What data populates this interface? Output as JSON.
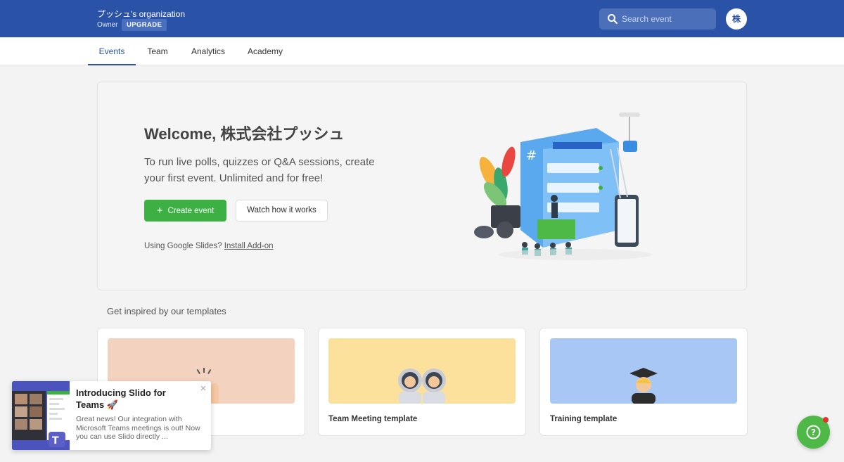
{
  "header": {
    "org_name": "プッシュ's organization",
    "role": "Owner",
    "upgrade_label": "UPGRADE",
    "search_placeholder": "Search event",
    "avatar_initial": "株"
  },
  "nav": {
    "tabs": [
      {
        "label": "Events",
        "active": true
      },
      {
        "label": "Team",
        "active": false
      },
      {
        "label": "Analytics",
        "active": false
      },
      {
        "label": "Academy",
        "active": false
      }
    ]
  },
  "welcome": {
    "title": "Welcome, 株式会社プッシュ",
    "subtitle": "To run live polls, quizzes or Q&A sessions, create your first event. Unlimited and for free!",
    "create_label": "Create event",
    "watch_label": "Watch how it works",
    "gslides_text": "Using Google Slides?",
    "gslides_link": "Install Add-on"
  },
  "templates": {
    "section_title": "Get inspired by our templates",
    "items": [
      {
        "label": "",
        "thumb_color": "#f3d3bf"
      },
      {
        "label": "Team Meeting template",
        "thumb_color": "#fbe19c"
      },
      {
        "label": "Training template",
        "thumb_color": "#a9c7f5"
      }
    ]
  },
  "popup": {
    "title": "Introducing Slido for Teams 🚀",
    "body": "Great news! Our integration with Microsoft Teams meetings is out! Now you can use Slido directly ...",
    "close_glyph": "×"
  },
  "help": {
    "glyph": "?"
  },
  "colors": {
    "brand_blue": "#2a53a8",
    "primary_green": "#3cb043",
    "help_green": "#4fb947",
    "notification_red": "#e5332a"
  }
}
